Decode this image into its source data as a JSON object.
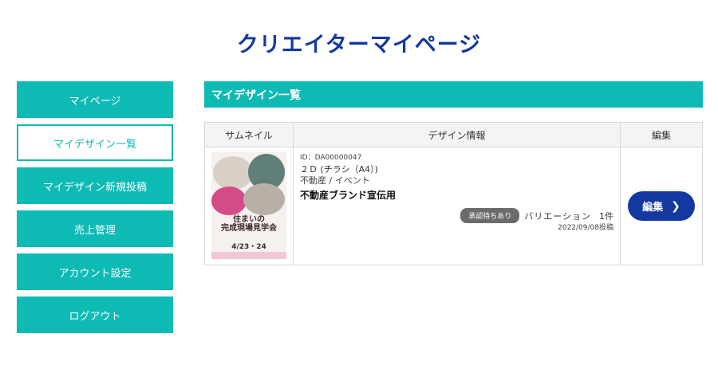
{
  "header": {
    "title": "クリエイターマイページ"
  },
  "sidebar": {
    "items": [
      {
        "label": "マイページ"
      },
      {
        "label": "マイデザイン一覧"
      },
      {
        "label": "マイデザイン新規投稿"
      },
      {
        "label": "売上管理"
      },
      {
        "label": "アカウント設定"
      },
      {
        "label": "ログアウト"
      }
    ],
    "active_index": 1
  },
  "main": {
    "section_title": "マイデザイン一覧",
    "table": {
      "columns": [
        "サムネイル",
        "デザイン情報",
        "編集"
      ],
      "rows": [
        {
          "thumbnail": {
            "title_line1": "住まいの",
            "title_line2": "完成現場見学会",
            "date": "4/23・24"
          },
          "id": "ID：DA00000047",
          "type": "２Ｄ (チラシ（A4）)",
          "category": "不動産 / イベント",
          "name": "不動産ブランド宣伝用",
          "status": "承認待ちあり",
          "variation_label": "バリエーション",
          "variation_count": "1件",
          "posted": "2022/09/08投稿",
          "edit_label": "編集"
        }
      ]
    }
  },
  "colors": {
    "teal": "#0ebab4",
    "navy": "#1339a0",
    "badge": "#6b6b6b"
  },
  "icons": {
    "edit_chevron": "chevron-right-icon"
  }
}
